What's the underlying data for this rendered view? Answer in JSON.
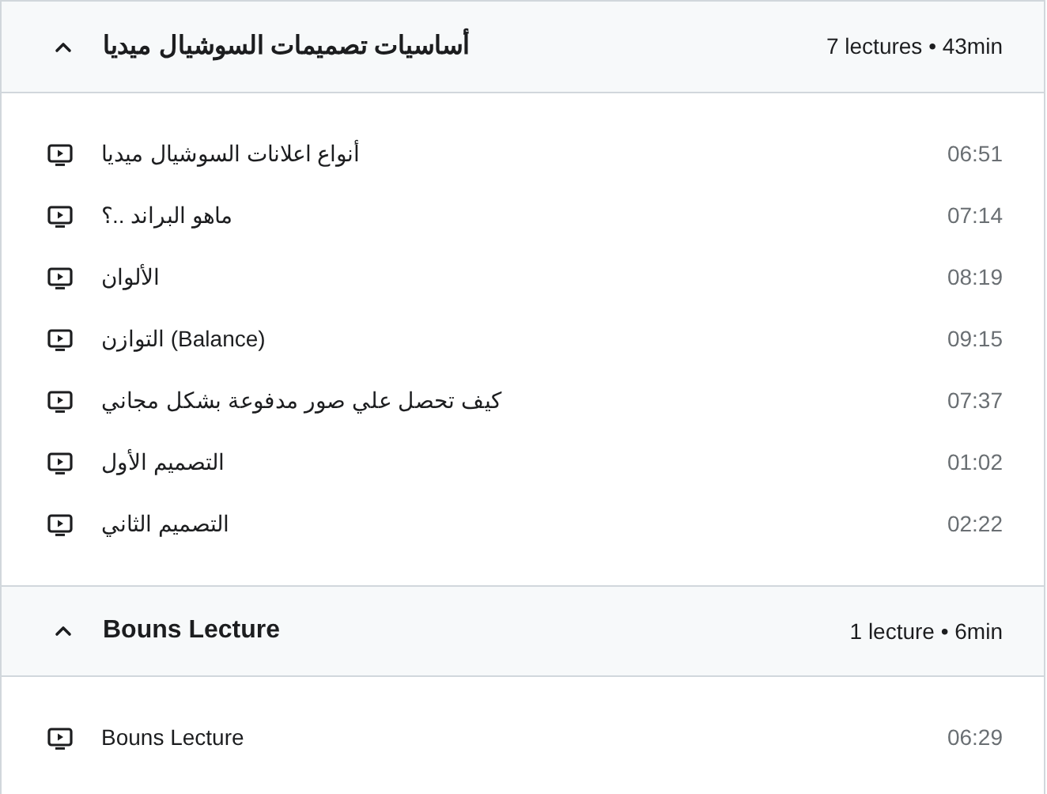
{
  "sections": [
    {
      "title": "أساسيات تصميمات السوشيال ميديا",
      "meta": "7 lectures • 43min",
      "expanded": true,
      "lectures": [
        {
          "title": "أنواع اعلانات السوشيال ميديا",
          "duration": "06:51"
        },
        {
          "title": "ماهو البراند ..؟",
          "duration": "07:14"
        },
        {
          "title": "الألوان",
          "duration": "08:19"
        },
        {
          "title": "التوازن (Balance)",
          "duration": "09:15"
        },
        {
          "title": "كيف تحصل علي صور مدفوعة بشكل مجاني",
          "duration": "07:37"
        },
        {
          "title": "التصميم الأول",
          "duration": "01:02"
        },
        {
          "title": "التصميم الثاني",
          "duration": "02:22"
        }
      ]
    },
    {
      "title": "Bouns Lecture",
      "meta": "1 lecture • 6min",
      "expanded": true,
      "lectures": [
        {
          "title": "Bouns Lecture",
          "duration": "06:29"
        }
      ]
    }
  ]
}
